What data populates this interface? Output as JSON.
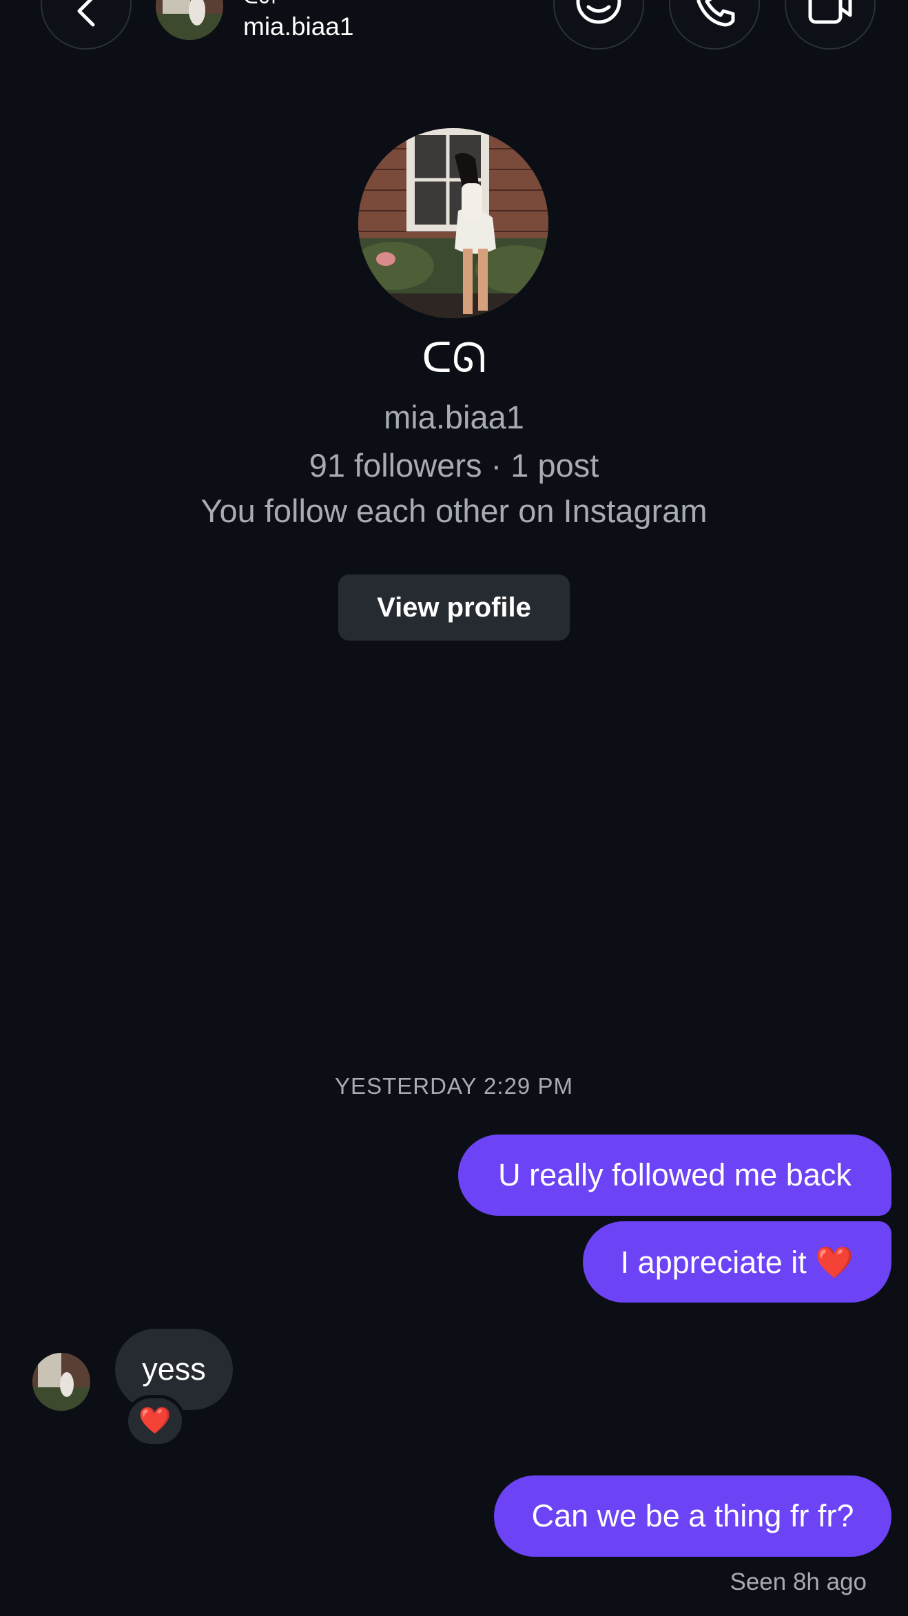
{
  "header": {
    "display_name": "ᑕᘏ",
    "username": "mia.biaa1",
    "icons": [
      "back-chevron-icon",
      "stickers-icon",
      "phone-icon",
      "video-icon"
    ]
  },
  "profile": {
    "display_name": "ᑕᘏ",
    "username": "mia.biaa1",
    "stats": "91 followers · 1 post",
    "mutual": "You follow each other on Instagram",
    "view_profile_label": "View profile"
  },
  "thread": {
    "timestamp": "YESTERDAY 2:29 PM",
    "messages": [
      {
        "sender": "me",
        "text": "U really followed me back"
      },
      {
        "sender": "me",
        "text": "I appreciate it ❤️"
      },
      {
        "sender": "them",
        "text": "yess",
        "reaction": "❤️"
      },
      {
        "sender": "me",
        "text": "Can we be a thing fr fr?"
      }
    ],
    "seen_status": "Seen 8h ago"
  },
  "colors": {
    "background": "#0b0e14",
    "sent_bubble": "#6c43f5",
    "received_bubble": "#262a31",
    "secondary_text": "#a8abb3"
  }
}
